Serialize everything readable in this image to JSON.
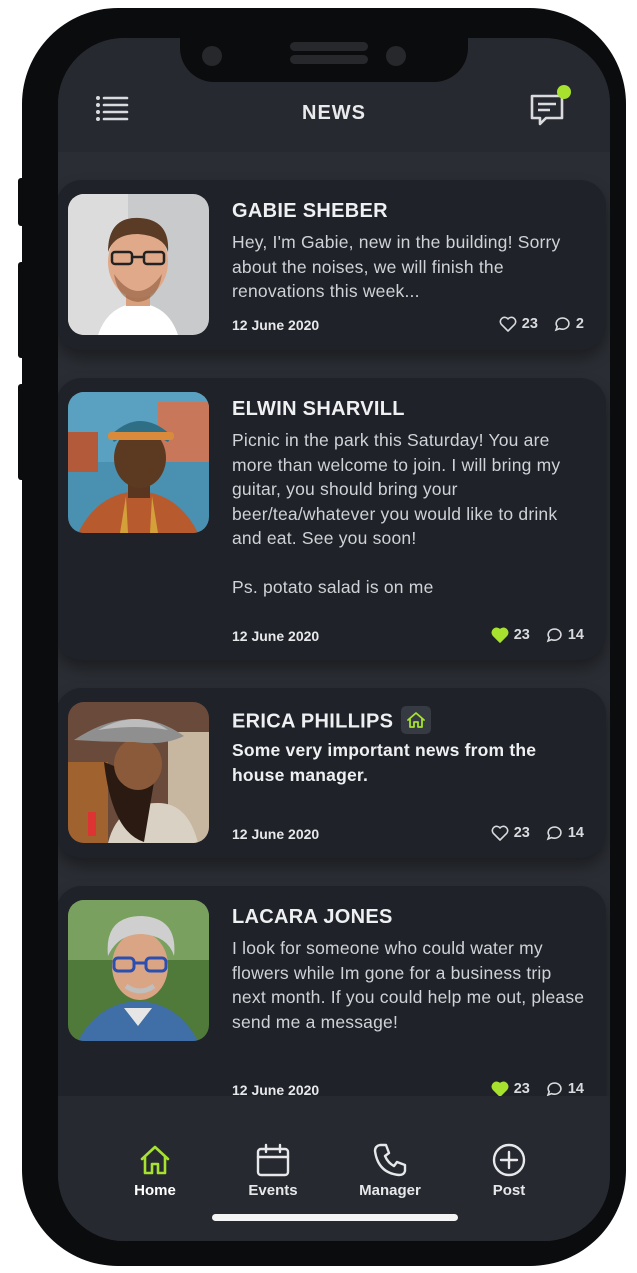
{
  "header": {
    "title": "NEWS"
  },
  "colors": {
    "accent": "#a6e22e",
    "background": "#2a2d33",
    "card": "#1f2228"
  },
  "posts": [
    {
      "name": "GABIE SHEBER",
      "text": "Hey, I'm Gabie, new in the building! Sorry about the noises, we will finish the renovations this week...",
      "date": "12 June 2020",
      "likes": "23",
      "comments": "2",
      "liked": false
    },
    {
      "name": "ELWIN SHARVILL",
      "text": "Picnic in the park this Saturday! You are more than welcome to join. I will bring my guitar, you should bring your beer/tea/whatever you would like to drink and eat. See you soon!\n\nPs. potato salad is on me",
      "date": "12 June 2020",
      "likes": "23",
      "comments": "14",
      "liked": true
    },
    {
      "name": "ERICA PHILLIPS",
      "text": "Some very important news from the house manager.",
      "date": "12 June 2020",
      "likes": "23",
      "comments": "14",
      "liked": false,
      "badge": "house-icon"
    },
    {
      "name": "LACARA JONES",
      "text": "I look for someone who could water my flowers while Im gone for a business trip next month. If you could help me out, please send me a message!",
      "date": "12 June 2020",
      "likes": "23",
      "comments": "14",
      "liked": true
    }
  ],
  "tabs": [
    {
      "label": "Home",
      "icon": "home-icon",
      "active": true
    },
    {
      "label": "Events",
      "icon": "calendar-icon",
      "active": false
    },
    {
      "label": "Manager",
      "icon": "phone-icon",
      "active": false
    },
    {
      "label": "Post",
      "icon": "plus-circle-icon",
      "active": false
    }
  ]
}
